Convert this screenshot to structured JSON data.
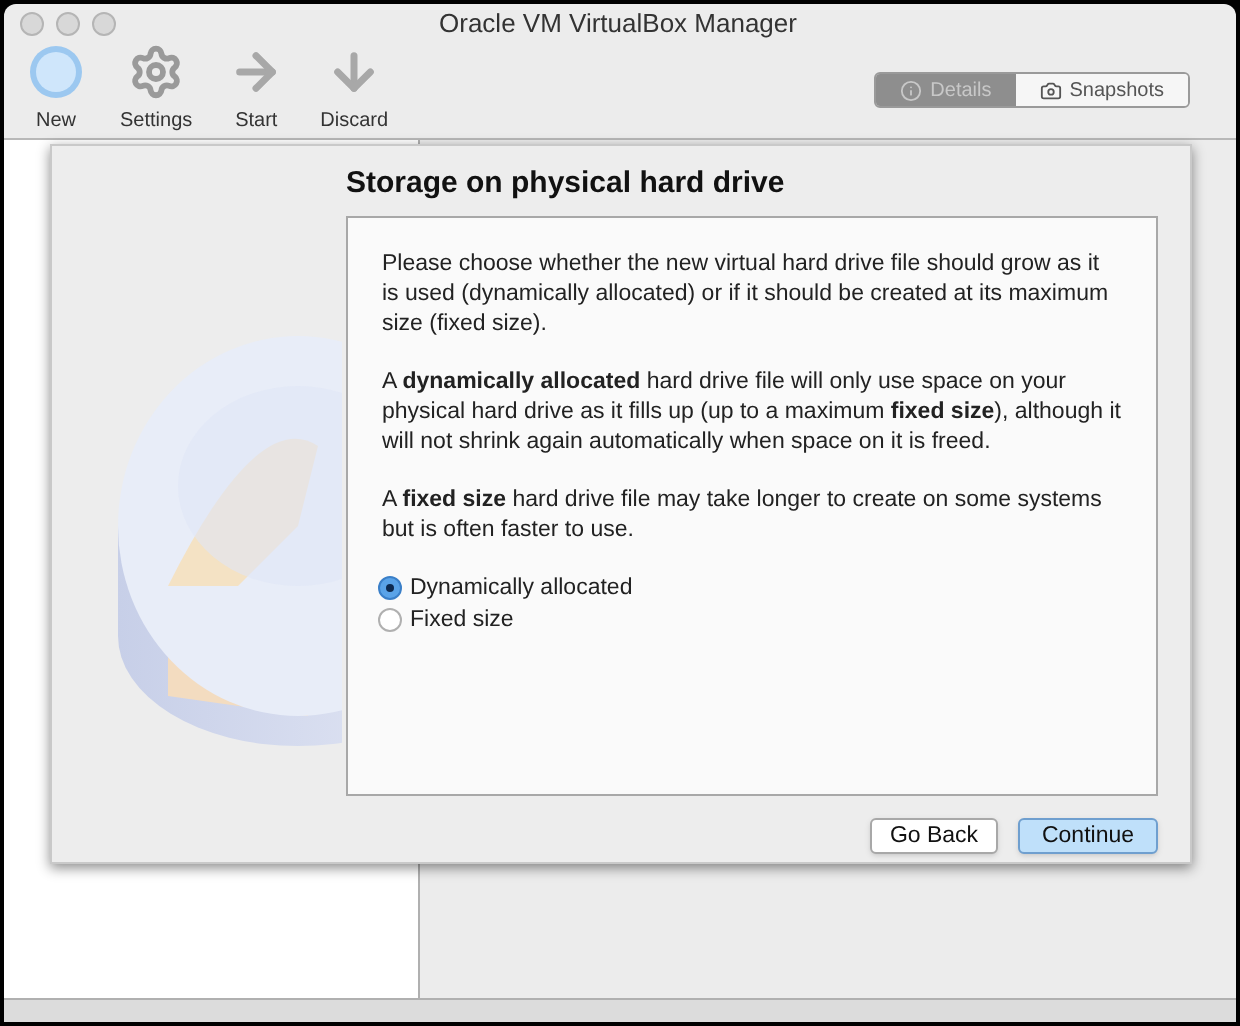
{
  "window": {
    "title": "Oracle VM VirtualBox Manager"
  },
  "toolbar": [
    {
      "kind": "new",
      "label": "New"
    },
    {
      "kind": "settings",
      "label": "Settings"
    },
    {
      "kind": "start",
      "label": "Start"
    },
    {
      "kind": "discard",
      "label": "Discard"
    }
  ],
  "view_tabs": [
    {
      "kind": "details",
      "label": "Details",
      "selected": true
    },
    {
      "kind": "snapshots",
      "label": "Snapshots",
      "selected": false
    }
  ],
  "dialog": {
    "title": "Storage on physical hard drive",
    "paragraphs": [
      "Please choose whether the new virtual hard drive file should grow as it is used (dynamically allocated) or if it should be created at its maximum size (fixed size).",
      "A **dynamically allocated** hard drive file will only use space on your physical hard drive as it fills up (up to a maximum **fixed size**), although it will not shrink again automatically when space on it is freed.",
      "A **fixed size** hard drive file may take longer to create on some systems but is often faster to use."
    ],
    "options": [
      {
        "label": "Dynamically allocated",
        "selected": true
      },
      {
        "label": "Fixed size",
        "selected": false
      }
    ],
    "buttons": [
      {
        "label": "Go Back",
        "kind": "secondary"
      },
      {
        "label": "Continue",
        "kind": "default"
      }
    ]
  }
}
